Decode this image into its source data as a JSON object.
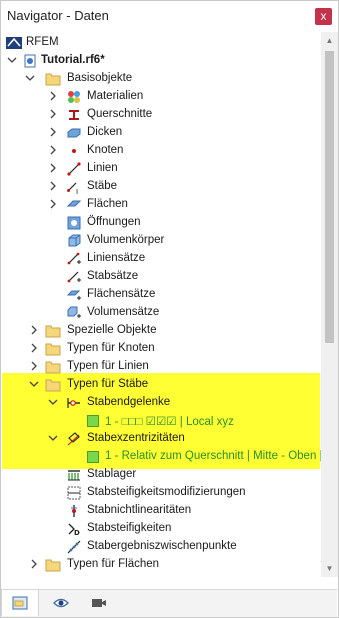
{
  "window": {
    "title": "Navigator - Daten",
    "close_label": "x"
  },
  "tree": {
    "root": "RFEM",
    "project": "Tutorial.rf6*",
    "basisobjekte": "Basisobjekte",
    "basis_items": [
      "Materialien",
      "Querschnitte",
      "Dicken",
      "Knoten",
      "Linien",
      "Stäbe",
      "Flächen",
      "Öffnungen",
      "Volumenkörper",
      "Liniensätze",
      "Stabsätze",
      "Flächensätze",
      "Volumensätze"
    ],
    "spezielle": "Spezielle Objekte",
    "typen_knoten": "Typen für Knoten",
    "typen_linien": "Typen für Linien",
    "typen_staebe": "Typen für Stäbe",
    "stabendgelenke": "Stabendgelenke",
    "gelenk_item": "1 - □□□ ☑☑☑ | Local xyz",
    "stabexzentrizitaeten": "Stabexzentrizitäten",
    "exz_item": "1 - Relativ zum Querschnitt | Mitte - Oben |",
    "staebe_items": [
      "Stablager",
      "Stabsteifigkeitsmodifizierungen",
      "Stabnichtlinearitäten",
      "Stabsteifigkeiten",
      "Stabergebniszwischenpunkte"
    ],
    "typen_flaechen": "Typen für Flächen"
  },
  "colors": {
    "highlight": "#ffff33",
    "folder": "#f5d67a",
    "green_text": "#2a8f2a",
    "close_button": "#c4314b"
  },
  "bottom_tabs": [
    "data-tab-icon",
    "eye-icon",
    "camera-icon"
  ]
}
